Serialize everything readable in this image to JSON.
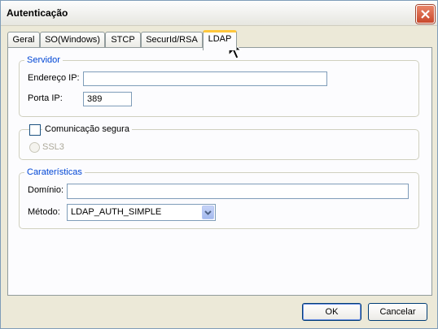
{
  "window": {
    "title": "Autenticação"
  },
  "tabs": [
    {
      "label": "Geral"
    },
    {
      "label": "SO(Windows)"
    },
    {
      "label": "STCP"
    },
    {
      "label": "SecurId/RSA"
    },
    {
      "label": "LDAP",
      "active": true
    }
  ],
  "servidor": {
    "legend": "Servidor",
    "address_label": "Endereço IP:",
    "address_value": "",
    "port_label": "Porta IP:",
    "port_value": "389"
  },
  "secure": {
    "checkbox_label": "Comunicação segura",
    "checked": false,
    "ssl_label": "SSL3"
  },
  "caracteristicas": {
    "legend": "Caraterísticas",
    "domain_label": "Domínio:",
    "domain_value": "",
    "method_label": "Método:",
    "method_value": "LDAP_AUTH_SIMPLE"
  },
  "footer": {
    "ok_label": "OK",
    "cancel_label": "Cancelar"
  },
  "colors": {
    "accent": "#0046d5",
    "tab_highlight": "#ffc73c",
    "close": "#c9472b"
  }
}
